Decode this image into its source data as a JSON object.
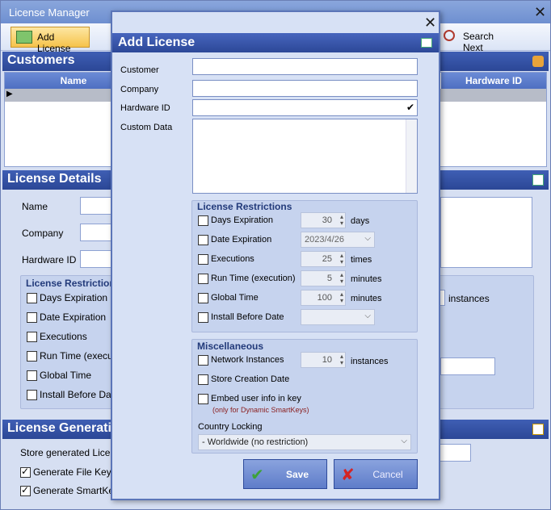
{
  "main": {
    "title": "License Manager",
    "close": "✕"
  },
  "toolbar": {
    "add_license": "Add License",
    "search_next": "Search Next"
  },
  "customers": {
    "header": "Customers",
    "col_name": "Name",
    "col_hw": "Hardware ID",
    "row_marker": "▶"
  },
  "details": {
    "header": "License Details",
    "name": "Name",
    "company": "Company",
    "hardware_id": "Hardware ID",
    "restrictions": "License Restrictions",
    "days": "Days Expiration",
    "date": "Date Expiration",
    "executions": "Executions",
    "runtime": "Run Time (executi",
    "global": "Global Time",
    "install": "Install Before Date",
    "instances": "instances"
  },
  "generation": {
    "header": "License Generatio",
    "store": "Store generated License",
    "file_key": "Generate File Key",
    "smart_key": "Generate SmartKey"
  },
  "dialog": {
    "title": "Add License",
    "close": "✕",
    "customer": "Customer",
    "company": "Company",
    "hardware_id": "Hardware ID",
    "custom_data": "Custom Data",
    "hw_check": "✔",
    "restrictions": "License Restrictions",
    "days_label": "Days Expiration",
    "days_val": "30",
    "days_unit": "days",
    "date_label": "Date Expiration",
    "date_val": "2023/4/26",
    "exec_label": "Executions",
    "exec_val": "25",
    "exec_unit": "times",
    "run_label": "Run Time (execution)",
    "run_val": "5",
    "run_unit": "minutes",
    "global_label": "Global Time",
    "global_val": "100",
    "global_unit": "minutes",
    "install_label": "Install Before Date",
    "install_val": "",
    "misc": "Miscellaneous",
    "net_label": "Network Instances",
    "net_val": "10",
    "net_unit": "instances",
    "store_label": "Store Creation Date",
    "embed_label": "Embed user info in key",
    "embed_note": "(only for Dynamic SmartKeys)",
    "country_label": "Country Locking",
    "country_val": "- Worldwide (no restriction)",
    "save": "Save",
    "cancel": "Cancel"
  }
}
